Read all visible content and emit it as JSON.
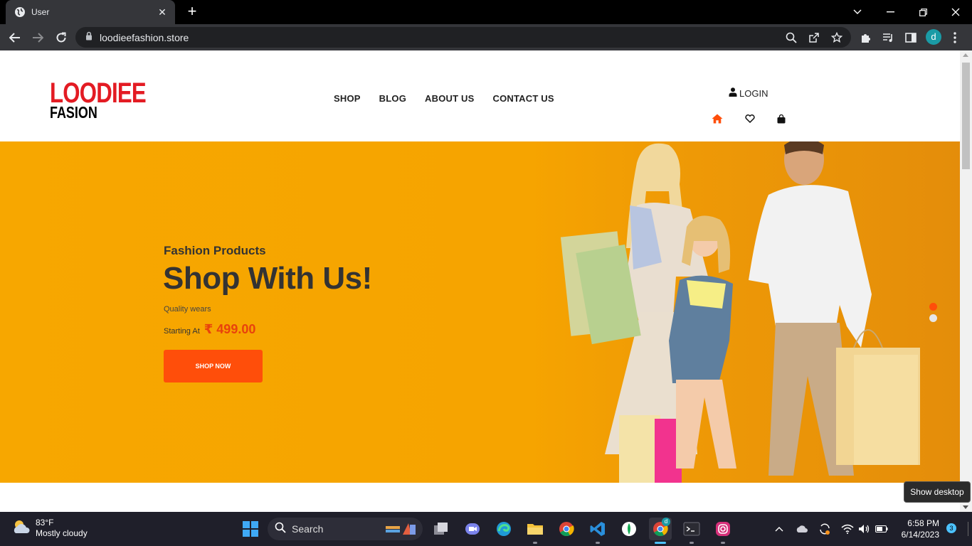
{
  "browser": {
    "tab_title": "User",
    "url": "loodieefashion.store",
    "profile_initial": "d"
  },
  "site": {
    "logo_line1": "LOODIEE",
    "logo_line2": "FASION",
    "nav": [
      "SHOP",
      "BLOG",
      "ABOUT US",
      "CONTACT US"
    ],
    "login_label": "LOGIN"
  },
  "hero": {
    "eyebrow": "Fashion Products",
    "headline": "Shop With Us!",
    "subtitle": "Quality wears",
    "price_label": "Starting At",
    "price": "₹ 499.00",
    "cta_label": "SHOP NOW",
    "slides": 2,
    "active_slide": 1
  },
  "tooltip": "Show desktop",
  "taskbar": {
    "weather_temp": "83°F",
    "weather_desc": "Mostly cloudy",
    "search_label": "Search",
    "time": "6:58 PM",
    "date": "6/14/2023",
    "notifications": "3",
    "chrome_badge": "d"
  },
  "colors": {
    "accent": "#ff4e0a",
    "hero_bg": "#f7a700",
    "logo_red": "#e31b23"
  }
}
